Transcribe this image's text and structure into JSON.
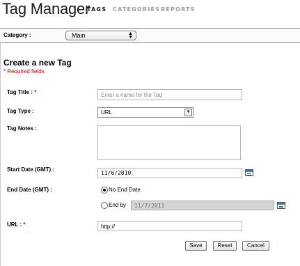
{
  "header": {
    "title": "Tag Manager",
    "tabs": [
      {
        "label": "TAGS",
        "active": true
      },
      {
        "label": "CATEGORIES",
        "active": false
      },
      {
        "label": "REPORTS",
        "active": false
      }
    ]
  },
  "category": {
    "label": "Category :",
    "selected": "Main"
  },
  "form": {
    "title": "Create a new Tag",
    "required_note": "* Required fields",
    "required_marker": "*",
    "tag_title": {
      "label": "Tag Title :",
      "placeholder": "Enter a name for the Tag",
      "value": ""
    },
    "tag_type": {
      "label": "Tag Type :",
      "selected": "URL"
    },
    "tag_notes": {
      "label": "Tag Notes :",
      "value": ""
    },
    "start_date": {
      "label": "Start Date (GMT) :",
      "value": "11/6/2010"
    },
    "end_date": {
      "label": "End Date (GMT) :",
      "option_none": "No End Date",
      "option_end_by": "End by",
      "end_by_value": "11/7/2011",
      "selected": "none"
    },
    "url": {
      "label": "URL :",
      "value": "http://"
    },
    "buttons": {
      "save": "Save",
      "reset": "Reset",
      "cancel": "Cancel"
    }
  },
  "colors": {
    "required": "#d00000",
    "active_tab": "#111111",
    "inactive_tab": "#9a9a9a"
  }
}
